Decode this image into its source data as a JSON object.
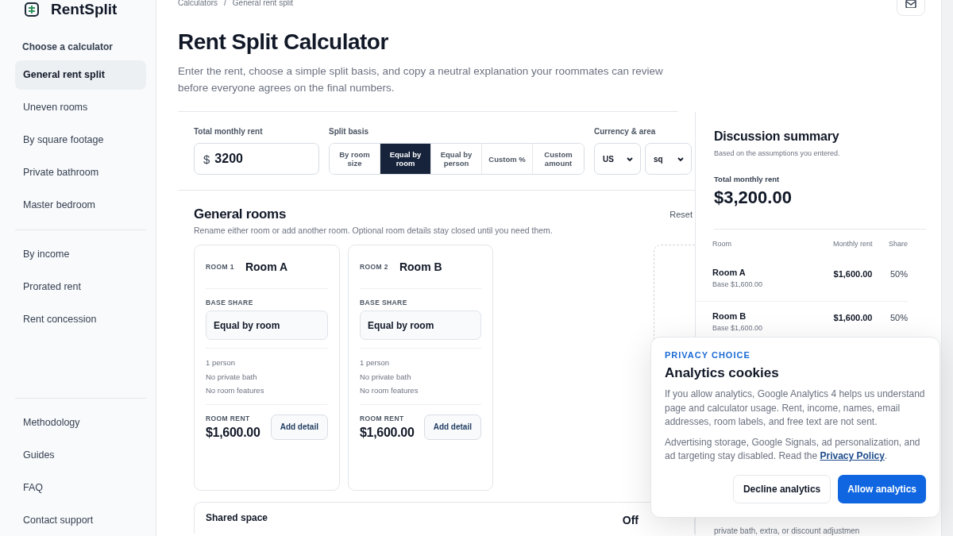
{
  "brand": {
    "name": "RentSplit"
  },
  "sidebar": {
    "heading": "Choose a calculator",
    "groups": [
      [
        {
          "label": "General rent split",
          "selected": true
        },
        {
          "label": "Uneven rooms",
          "selected": false
        },
        {
          "label": "By square footage",
          "selected": false
        },
        {
          "label": "Private bathroom",
          "selected": false
        },
        {
          "label": "Master bedroom",
          "selected": false
        }
      ],
      [
        {
          "label": "By income",
          "selected": false
        },
        {
          "label": "Prorated rent",
          "selected": false
        },
        {
          "label": "Rent concession",
          "selected": false
        }
      ],
      [
        {
          "label": "Methodology",
          "selected": false
        },
        {
          "label": "Guides",
          "selected": false
        },
        {
          "label": "FAQ",
          "selected": false
        },
        {
          "label": "Contact support",
          "selected": false
        }
      ]
    ]
  },
  "breadcrumb": [
    "Calculators",
    "/",
    "General rent split"
  ],
  "title": "Rent Split Calculator",
  "subtitle": "Enter the rent, choose a simple split basis, and copy a neutral explanation your roommates can review before everyone agrees on the final numbers.",
  "rent_field": {
    "label": "Total monthly rent",
    "prefix": "$",
    "value": "3200"
  },
  "split_basis": {
    "label": "Split basis",
    "options": [
      {
        "label": "By room size",
        "selected": false
      },
      {
        "label": "Equal by room",
        "selected": true
      },
      {
        "label": "Equal by person",
        "selected": false
      },
      {
        "label": "Custom %",
        "selected": false
      },
      {
        "label": "Custom amount",
        "selected": false
      }
    ]
  },
  "currency_area": {
    "label": "Currency & area",
    "selects": [
      "US",
      "sq"
    ]
  },
  "rooms_section": {
    "title": "General rooms",
    "subtitle": "Rename either room or add another room. Optional room details stay closed until you need them.",
    "reset": "Reset",
    "rooms": [
      {
        "number": "ROOM 1",
        "name": "Room A",
        "base_label": "BASE SHARE",
        "base_value": "Equal by room",
        "details": [
          "1 person",
          "No private bath",
          "No room features"
        ],
        "rent_label": "ROOM RENT",
        "rent": "$1,600.00",
        "button": "Add detail"
      },
      {
        "number": "ROOM 2",
        "name": "Room B",
        "base_label": "BASE SHARE",
        "base_value": "Equal by room",
        "details": [
          "1 person",
          "No private bath",
          "No room features"
        ],
        "rent_label": "ROOM RENT",
        "rent": "$1,600.00",
        "button": "Add detail"
      }
    ]
  },
  "shared_space": {
    "title": "Shared space",
    "state": "Off"
  },
  "summary": {
    "title": "Discussion summary",
    "subtitle": "Based on the assumptions you entered.",
    "total_label": "Total monthly rent",
    "total": "$3,200.00",
    "columns": [
      "Room",
      "Monthly rent",
      "Share"
    ],
    "rows": [
      {
        "room": "Room A",
        "base": "Base $1,600.00",
        "rent": "$1,600.00",
        "share": "50%"
      },
      {
        "room": "Room B",
        "base": "Base $1,600.00",
        "rent": "$1,600.00",
        "share": "50%"
      }
    ],
    "note": "private bath, extra, or discount adjustmen"
  },
  "cookie_dialog": {
    "eyebrow": "PRIVACY CHOICE",
    "title": "Analytics cookies",
    "body": "If you allow analytics, Google Analytics 4 helps us understand page and calculator usage. Rent, income, names, email addresses, room labels, and free text are not sent.",
    "body2": "Advertising storage, Google Signals, ad personalization, and ad targeting stay disabled. Read the ",
    "link": "Privacy Policy",
    "body2_end": ".",
    "buttons": [
      {
        "label": "Decline analytics",
        "kind": "secondary"
      },
      {
        "label": "Allow analytics",
        "kind": "primary"
      }
    ]
  }
}
